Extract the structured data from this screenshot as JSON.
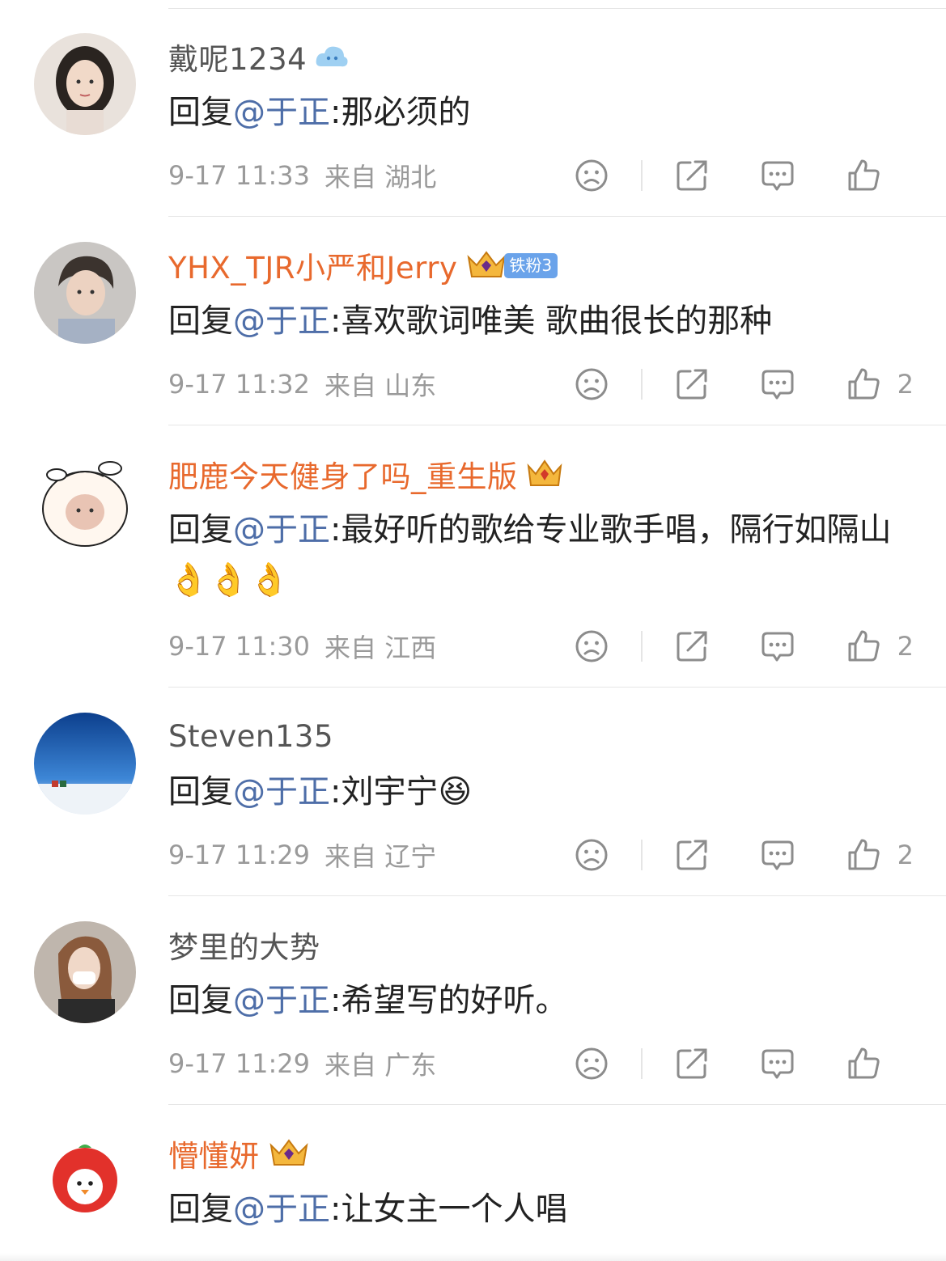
{
  "comments": [
    {
      "username": "戴呢1234",
      "name_style": "plain",
      "badge": "cloud",
      "reply_prefix": "回复",
      "mention": "@于正",
      "text": ":那必须的",
      "time": "9-17 11:33",
      "from": "来自 湖北",
      "likes": ""
    },
    {
      "username": "YHX_TJR小严和Jerry",
      "name_style": "vip",
      "badge": "crown",
      "fan_tag": "铁粉3",
      "reply_prefix": "回复",
      "mention": "@于正",
      "text": ":喜欢歌词唯美 歌曲很长的那种",
      "time": "9-17 11:32",
      "from": "来自 山东",
      "likes": "2"
    },
    {
      "username": "肥鹿今天健身了吗_重生版",
      "name_style": "vip",
      "badge": "crown",
      "reply_prefix": "回复",
      "mention": "@于正",
      "text": ":最好听的歌给专业歌手唱，隔行如隔山",
      "emoji": "👌👌👌",
      "time": "9-17 11:30",
      "from": "来自 江西",
      "likes": "2"
    },
    {
      "username": "Steven135",
      "name_style": "plain",
      "badge": "",
      "reply_prefix": "回复",
      "mention": "@于正",
      "text": ":刘宇宁",
      "emoji": "😆",
      "time": "9-17 11:29",
      "from": "来自 辽宁",
      "likes": "2"
    },
    {
      "username": "梦里的大势",
      "name_style": "plain",
      "badge": "",
      "reply_prefix": "回复",
      "mention": "@于正",
      "text": ":希望写的好听。",
      "time": "9-17 11:29",
      "from": "来自 广东",
      "likes": ""
    },
    {
      "username": "懵懂妍",
      "name_style": "vip",
      "badge": "crown",
      "reply_prefix": "回复",
      "mention": "@于正",
      "text": ":让女主一个人唱",
      "time": "",
      "from": "",
      "likes": ""
    }
  ],
  "icons": {
    "dislike": "frown-icon",
    "share": "share-icon",
    "comment": "comment-icon",
    "like": "thumbs-up-icon"
  },
  "colors": {
    "mention": "#4e6ea8",
    "vip_name": "#e8692d",
    "meta": "#9a9a9a",
    "fan_tag": "#6aa3ea"
  }
}
